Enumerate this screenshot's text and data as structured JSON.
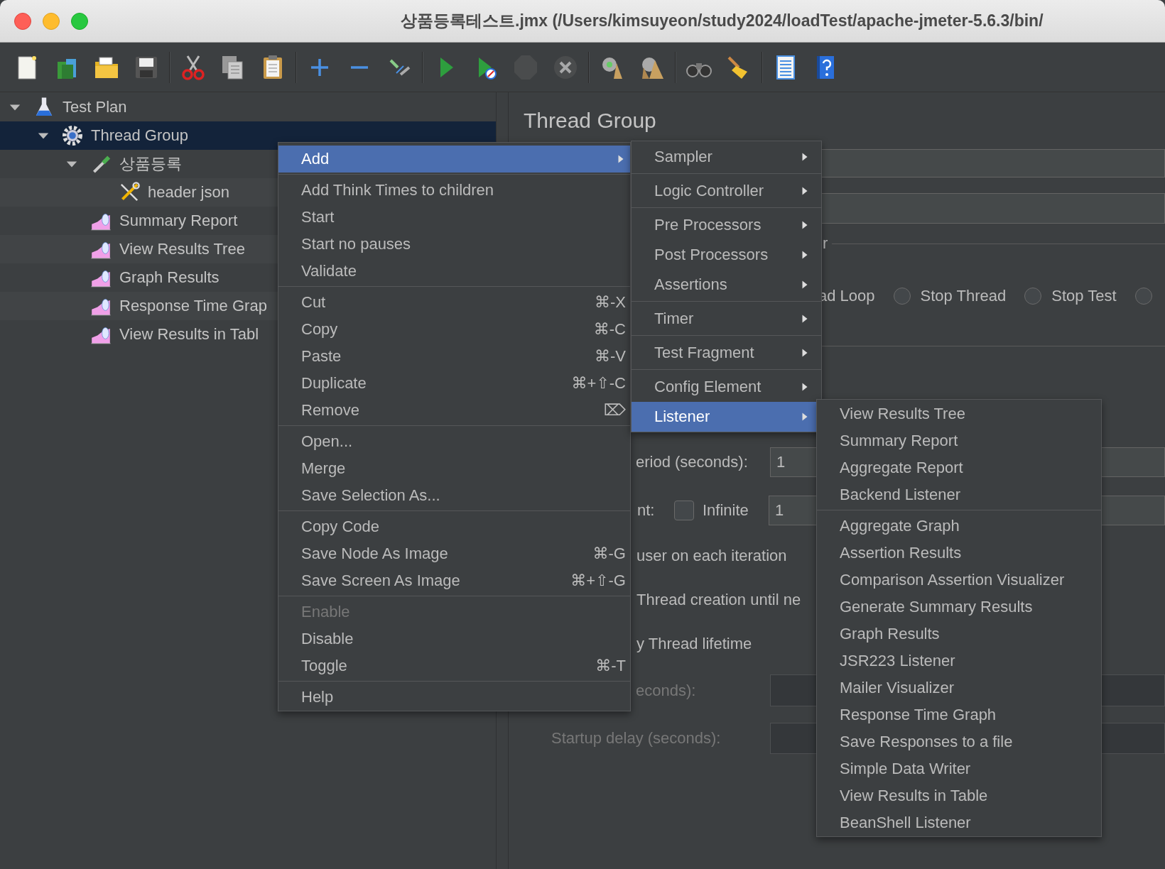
{
  "window": {
    "title": "상품등록테스트.jmx (/Users/kimsuyeon/study2024/loadTest/apache-jmeter-5.6.3/bin/"
  },
  "toolbar": [
    {
      "kind": "new",
      "disabled": false
    },
    {
      "kind": "templates",
      "disabled": false
    },
    {
      "kind": "open",
      "disabled": false
    },
    {
      "kind": "save",
      "disabled": false
    },
    {
      "kind": "separator"
    },
    {
      "kind": "cut",
      "disabled": false
    },
    {
      "kind": "copy",
      "disabled": false
    },
    {
      "kind": "paste",
      "disabled": false
    },
    {
      "kind": "separator"
    },
    {
      "kind": "expand",
      "disabled": false
    },
    {
      "kind": "collapse",
      "disabled": false
    },
    {
      "kind": "toggle",
      "disabled": false
    },
    {
      "kind": "separator"
    },
    {
      "kind": "start",
      "disabled": false
    },
    {
      "kind": "start-no-pause",
      "disabled": false
    },
    {
      "kind": "stop",
      "disabled": true
    },
    {
      "kind": "shutdown",
      "disabled": true
    },
    {
      "kind": "separator"
    },
    {
      "kind": "clear",
      "disabled": false
    },
    {
      "kind": "clear-all",
      "disabled": false
    },
    {
      "kind": "separator"
    },
    {
      "kind": "search",
      "disabled": false
    },
    {
      "kind": "reset-search",
      "disabled": false
    },
    {
      "kind": "separator"
    },
    {
      "kind": "function-helper",
      "disabled": false
    },
    {
      "kind": "help",
      "disabled": false
    }
  ],
  "tree": [
    {
      "label": "Test Plan",
      "kind": "test-plan",
      "expanded": true,
      "selected": false,
      "children": [
        {
          "label": "Thread Group",
          "kind": "thread-group",
          "expanded": true,
          "selected": true,
          "children": [
            {
              "label": "상품등록",
              "kind": "sampler",
              "expanded": true,
              "selected": false,
              "children": [
                {
                  "label": "header json",
                  "kind": "config",
                  "selected": false
                }
              ]
            },
            {
              "label": "Summary Report",
              "kind": "listener",
              "selected": false
            },
            {
              "label": "View Results Tree",
              "kind": "listener",
              "selected": false
            },
            {
              "label": "Graph Results",
              "kind": "listener",
              "selected": false
            },
            {
              "label": "Response Time Grap",
              "kind": "listener",
              "selected": false
            },
            {
              "label": "View Results in Tabl",
              "kind": "listener",
              "selected": false
            }
          ]
        }
      ]
    }
  ],
  "panel": {
    "title": "Thread Group",
    "error_label": "r",
    "error_actions": [
      {
        "label": "ad Loop"
      },
      {
        "label": "Stop Thread",
        "selected": false
      },
      {
        "label": "Stop Test",
        "selected": false
      },
      {
        "selected": false
      }
    ],
    "ramp_up": {
      "label": "eriod (seconds):",
      "value": "1"
    },
    "loop_count": {
      "label": "nt:",
      "infinite": {
        "label": "Infinite",
        "checked": false
      },
      "value": "1"
    },
    "same_user": "user on each iteration",
    "delay_creation": "Thread creation until ne",
    "lifetime": "y Thread lifetime",
    "duration": {
      "label": "econds):",
      "disabled": true
    },
    "startup_delay": {
      "label": "Startup delay (seconds):",
      "disabled": true
    }
  },
  "context_menu": [
    {
      "kind": "item",
      "label": "Add",
      "selected": true,
      "submenu": true,
      "disabled": false
    },
    {
      "kind": "separator"
    },
    {
      "kind": "item",
      "label": "Add Think Times to children",
      "selected": false,
      "submenu": false,
      "disabled": false
    },
    {
      "kind": "item",
      "label": "Start",
      "selected": false,
      "submenu": false,
      "disabled": false
    },
    {
      "kind": "item",
      "label": "Start no pauses",
      "selected": false,
      "submenu": false,
      "disabled": false
    },
    {
      "kind": "item",
      "label": "Validate",
      "selected": false,
      "submenu": false,
      "disabled": false
    },
    {
      "kind": "separator"
    },
    {
      "kind": "item",
      "label": "Cut",
      "shortcut": "⌘-X",
      "selected": false,
      "submenu": false,
      "disabled": false
    },
    {
      "kind": "item",
      "label": "Copy",
      "shortcut": "⌘-C",
      "selected": false,
      "submenu": false,
      "disabled": false
    },
    {
      "kind": "item",
      "label": "Paste",
      "shortcut": "⌘-V",
      "selected": false,
      "submenu": false,
      "disabled": false
    },
    {
      "kind": "item",
      "label": "Duplicate",
      "shortcut": "⌘+⇧-C",
      "selected": false,
      "submenu": false,
      "disabled": false
    },
    {
      "kind": "item",
      "label": "Remove",
      "shortcut": "⌦",
      "selected": false,
      "submenu": false,
      "disabled": false
    },
    {
      "kind": "separator"
    },
    {
      "kind": "item",
      "label": "Open...",
      "selected": false,
      "submenu": false,
      "disabled": false
    },
    {
      "kind": "item",
      "label": "Merge",
      "selected": false,
      "submenu": false,
      "disabled": false
    },
    {
      "kind": "item",
      "label": "Save Selection As...",
      "selected": false,
      "submenu": false,
      "disabled": false
    },
    {
      "kind": "separator"
    },
    {
      "kind": "item",
      "label": "Copy Code",
      "selected": false,
      "submenu": false,
      "disabled": false
    },
    {
      "kind": "item",
      "label": "Save Node As Image",
      "shortcut": "⌘-G",
      "selected": false,
      "submenu": false,
      "disabled": false
    },
    {
      "kind": "item",
      "label": "Save Screen As Image",
      "shortcut": "⌘+⇧-G",
      "selected": false,
      "submenu": false,
      "disabled": false
    },
    {
      "kind": "separator"
    },
    {
      "kind": "item",
      "label": "Enable",
      "selected": false,
      "submenu": false,
      "disabled": true
    },
    {
      "kind": "item",
      "label": "Disable",
      "selected": false,
      "submenu": false,
      "disabled": false
    },
    {
      "kind": "item",
      "label": "Toggle",
      "shortcut": "⌘-T",
      "selected": false,
      "submenu": false,
      "disabled": false
    },
    {
      "kind": "separator"
    },
    {
      "kind": "item",
      "label": "Help",
      "selected": false,
      "submenu": false,
      "disabled": false
    }
  ],
  "add_submenu": [
    {
      "kind": "item",
      "label": "Sampler",
      "selected": false
    },
    {
      "kind": "separator"
    },
    {
      "kind": "item",
      "label": "Logic Controller",
      "selected": false
    },
    {
      "kind": "separator"
    },
    {
      "kind": "item",
      "label": "Pre Processors",
      "selected": false
    },
    {
      "kind": "item",
      "label": "Post Processors",
      "selected": false
    },
    {
      "kind": "item",
      "label": "Assertions",
      "selected": false
    },
    {
      "kind": "separator"
    },
    {
      "kind": "item",
      "label": "Timer",
      "selected": false
    },
    {
      "kind": "separator"
    },
    {
      "kind": "item",
      "label": "Test Fragment",
      "selected": false
    },
    {
      "kind": "separator"
    },
    {
      "kind": "item",
      "label": "Config Element",
      "selected": false
    },
    {
      "kind": "item",
      "label": "Listener",
      "selected": true
    }
  ],
  "listener_submenu": [
    {
      "kind": "item",
      "label": "View Results Tree",
      "selected": false
    },
    {
      "kind": "item",
      "label": "Summary Report",
      "selected": false
    },
    {
      "kind": "item",
      "label": "Aggregate Report",
      "selected": false
    },
    {
      "kind": "item",
      "label": "Backend Listener",
      "selected": false
    },
    {
      "kind": "separator"
    },
    {
      "kind": "item",
      "label": "Aggregate Graph",
      "selected": false
    },
    {
      "kind": "item",
      "label": "Assertion Results",
      "selected": false
    },
    {
      "kind": "item",
      "label": "Comparison Assertion Visualizer",
      "selected": false
    },
    {
      "kind": "item",
      "label": "Generate Summary Results",
      "selected": false
    },
    {
      "kind": "item",
      "label": "Graph Results",
      "selected": false
    },
    {
      "kind": "item",
      "label": "JSR223 Listener",
      "selected": false
    },
    {
      "kind": "item",
      "label": "Mailer Visualizer",
      "selected": false
    },
    {
      "kind": "item",
      "label": "Response Time Graph",
      "selected": false
    },
    {
      "kind": "item",
      "label": "Save Responses to a file",
      "selected": false
    },
    {
      "kind": "item",
      "label": "Simple Data Writer",
      "selected": false
    },
    {
      "kind": "item",
      "label": "View Results in Table",
      "selected": false
    },
    {
      "kind": "item",
      "label": "BeanShell Listener",
      "selected": false
    }
  ]
}
